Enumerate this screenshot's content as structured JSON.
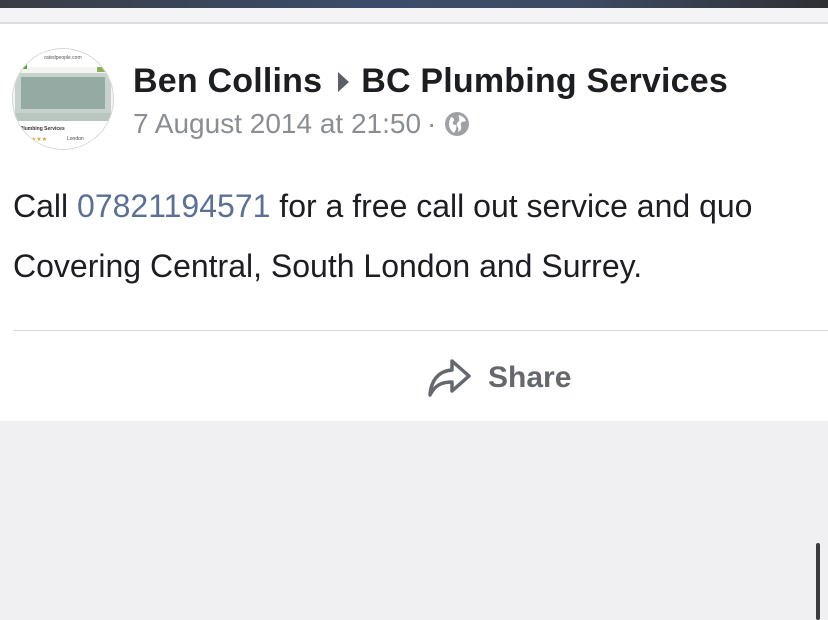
{
  "post": {
    "author": "Ben Collins",
    "page": "BC Plumbing Services",
    "timestamp": "7 August 2014 at 21:50",
    "separator": "·",
    "privacy_icon": "globe-icon",
    "text_prefix": "Call ",
    "phone": "07821194571",
    "text_suffix": " for a free call out service and quo",
    "text_line2": "Covering Central, South London and Surrey."
  },
  "avatar_thumb": {
    "site": "ratedpeople.com",
    "business": "C Plumbing Services",
    "location": "London"
  },
  "actions": {
    "share_label": "Share",
    "share_icon": "share-arrow-icon"
  },
  "colors": {
    "link": "#5b7092",
    "text": "#1c1e21",
    "meta": "#8a8d91"
  }
}
